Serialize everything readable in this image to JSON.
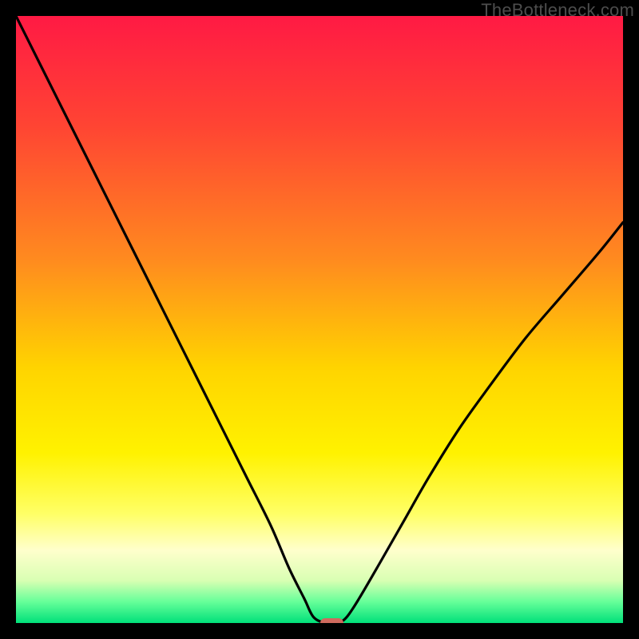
{
  "watermark": "TheBottleneck.com",
  "chart_data": {
    "type": "line",
    "title": "",
    "xlabel": "",
    "ylabel": "",
    "xlim": [
      0,
      100
    ],
    "ylim": [
      0,
      100
    ],
    "grid": false,
    "legend": false,
    "gradient_stops": [
      {
        "offset": 0.0,
        "color": "#ff1a44"
      },
      {
        "offset": 0.18,
        "color": "#ff4433"
      },
      {
        "offset": 0.4,
        "color": "#ff8a1f"
      },
      {
        "offset": 0.58,
        "color": "#ffd400"
      },
      {
        "offset": 0.72,
        "color": "#fff200"
      },
      {
        "offset": 0.82,
        "color": "#ffff66"
      },
      {
        "offset": 0.88,
        "color": "#ffffcc"
      },
      {
        "offset": 0.93,
        "color": "#d9ffb3"
      },
      {
        "offset": 0.965,
        "color": "#66ff99"
      },
      {
        "offset": 1.0,
        "color": "#00e07a"
      }
    ],
    "series": [
      {
        "name": "bottleneck-curve",
        "color": "#000000",
        "x": [
          0.0,
          3.0,
          6.5,
          10.0,
          14.0,
          18.0,
          22.0,
          26.0,
          30.0,
          34.0,
          38.0,
          42.0,
          45.0,
          47.5,
          49.0,
          51.0,
          53.0,
          54.5,
          56.5,
          60.0,
          64.0,
          68.0,
          73.0,
          78.0,
          84.0,
          90.0,
          96.0,
          100.0
        ],
        "y": [
          100.0,
          94.0,
          87.0,
          80.0,
          72.0,
          64.0,
          56.0,
          48.0,
          40.0,
          32.0,
          24.0,
          16.0,
          9.0,
          4.0,
          1.0,
          0.0,
          0.0,
          1.0,
          4.0,
          10.0,
          17.0,
          24.0,
          32.0,
          39.0,
          47.0,
          54.0,
          61.0,
          66.0
        ]
      }
    ],
    "marker": {
      "x": 52.0,
      "y": 0.0,
      "width_pct": 3.8,
      "height_pct": 1.6,
      "color": "#cf6a5e"
    }
  }
}
